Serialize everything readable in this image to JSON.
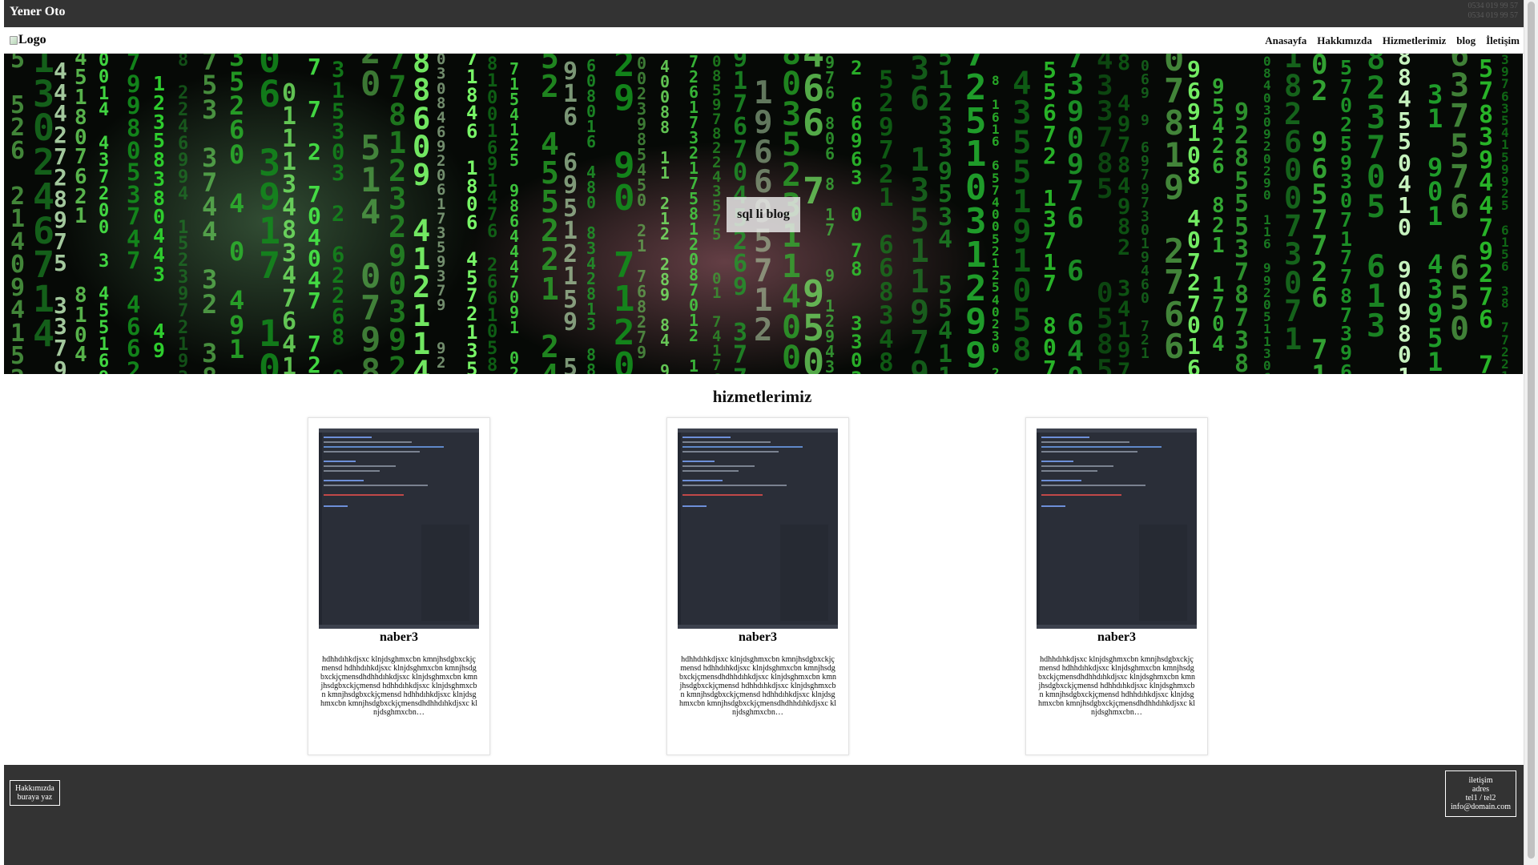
{
  "topbar": {
    "brand": "Yener Oto",
    "phones": [
      "0534 019 99 57",
      "0534 019 99 57"
    ]
  },
  "navbar": {
    "logo_alt": "Logo",
    "items": [
      "Anasayfa",
      "Hakkımızda",
      "Hizmetlerimiz",
      "blog",
      "İletişim"
    ]
  },
  "hero": {
    "button_label": "sql li blog"
  },
  "services": {
    "title": "hizmetlerimiz",
    "cards": [
      {
        "title": "naber3",
        "text": "hdhhdıhkdjsxc klnjdsghmxcbn kmnjhsdgbxckjçmensd hdhhdıhkdjsxc klnjdsghmxcbn kmnjhsdgbxckjçmensdhdhhdıhkdjsxc klnjdsghmxcbn kmnjhsdgbxckjçmensd hdhhdıhkdjsxc klnjdsghmxcbn kmnjhsdgbxckjçmensd hdhhdıhkdjsxc klnjdsghmxcbn kmnjhsdgbxckjçmensdhdhhdıhkdjsxc klnjdsghmxcbn…"
      },
      {
        "title": "naber3",
        "text": "hdhhdıhkdjsxc klnjdsghmxcbn kmnjhsdgbxckjçmensd hdhhdıhkdjsxc klnjdsghmxcbn kmnjhsdgbxckjçmensdhdhhdıhkdjsxc klnjdsghmxcbn kmnjhsdgbxckjçmensd hdhhdıhkdjsxc klnjdsghmxcbn kmnjhsdgbxckjçmensd hdhhdıhkdjsxc klnjdsghmxcbn kmnjhsdgbxckjçmensdhdhhdıhkdjsxc klnjdsghmxcbn…"
      },
      {
        "title": "naber3",
        "text": "hdhhdıhkdjsxc klnjdsghmxcbn kmnjhsdgbxckjçmensd hdhhdıhkdjsxc klnjdsghmxcbn kmnjhsdgbxckjçmensdhdhhdıhkdjsxc klnjdsghmxcbn kmnjhsdgbxckjçmensd hdhhdıhkdjsxc klnjdsghmxcbn kmnjhsdgbxckjçmensd hdhhdıhkdjsxc klnjdsghmxcbn kmnjhsdgbxckjçmensdhdhhdıhkdjsxc klnjdsghmxcbn…"
      }
    ]
  },
  "footer": {
    "about_lines": [
      "Hakkımızda",
      "buraya yaz"
    ],
    "contact_lines": [
      "iletişim",
      "adres",
      "tel1 / tel2",
      "info@domain.com"
    ]
  },
  "colors": {
    "dark_bar": "#333333",
    "matrix_green": "#39ff14"
  }
}
